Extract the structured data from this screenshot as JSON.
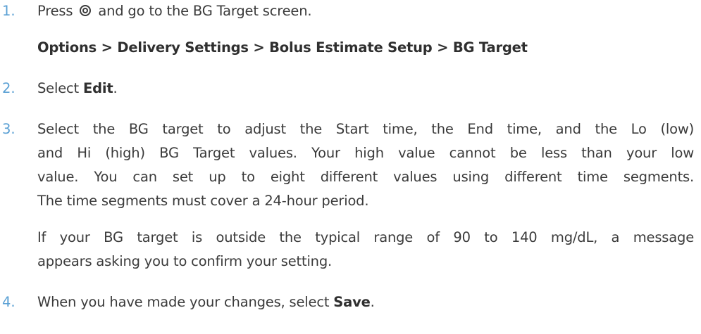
{
  "steps": [
    {
      "number": "1.",
      "text_before_icon": "Press",
      "icon": "options-button-icon",
      "text_after_icon": "and go to the BG Target screen.",
      "path": "Options > Delivery Settings > Bolus Estimate Setup > BG Target"
    },
    {
      "number": "2.",
      "text_before": "Select ",
      "bold": "Edit",
      "text_after": "."
    },
    {
      "number": "3.",
      "lines": [
        "Select the BG target to adjust the Start time, the End time, and the Lo (low)",
        "and Hi (high) BG Target values. Your high value cannot be less than your low",
        "value. You can set up to eight different values using different time segments.",
        "The time segments must cover a 24-hour period."
      ],
      "note_lines": [
        "If your BG target is outside the typical range of 90 to 140 mg/dL, a message",
        "appears asking you to confirm your setting."
      ]
    },
    {
      "number": "4.",
      "text_before": "When you have made your changes, select ",
      "bold": "Save",
      "text_after": "."
    }
  ]
}
